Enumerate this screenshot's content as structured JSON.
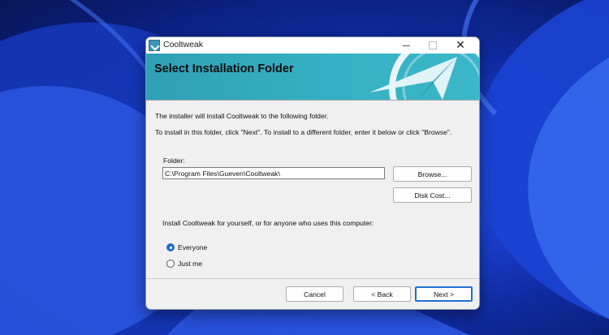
{
  "window": {
    "title": "Cooltweak",
    "icon": "cooltweak-app-icon",
    "controls": {
      "minimize": "minimize-icon",
      "maximize": "maximize-icon",
      "close": "close-icon"
    }
  },
  "banner": {
    "title": "Select Installation Folder",
    "accent_color": "#36b0c4"
  },
  "intro": {
    "line1": "The installer will install Cooltweak to the following folder.",
    "line2": "To install in this folder, click \"Next\". To install to a different folder, enter it below or click \"Browse\"."
  },
  "folder": {
    "label": "Folder:",
    "value": "C:\\Program Files\\Gueven\\Cooltweak\\"
  },
  "buttons": {
    "browse": "Browse...",
    "disk_cost": "Disk Cost...",
    "cancel": "Cancel",
    "back": "< Back",
    "next": "Next >"
  },
  "install_for": {
    "prompt": "Install Cooltweak for yourself, or for anyone who uses this computer:",
    "options": [
      {
        "label": "Everyone",
        "selected": true
      },
      {
        "label": "Just me",
        "selected": false
      }
    ]
  },
  "colors": {
    "focus_blue": "#1e6fd0",
    "wallpaper_blue": "#1a3fcf"
  }
}
